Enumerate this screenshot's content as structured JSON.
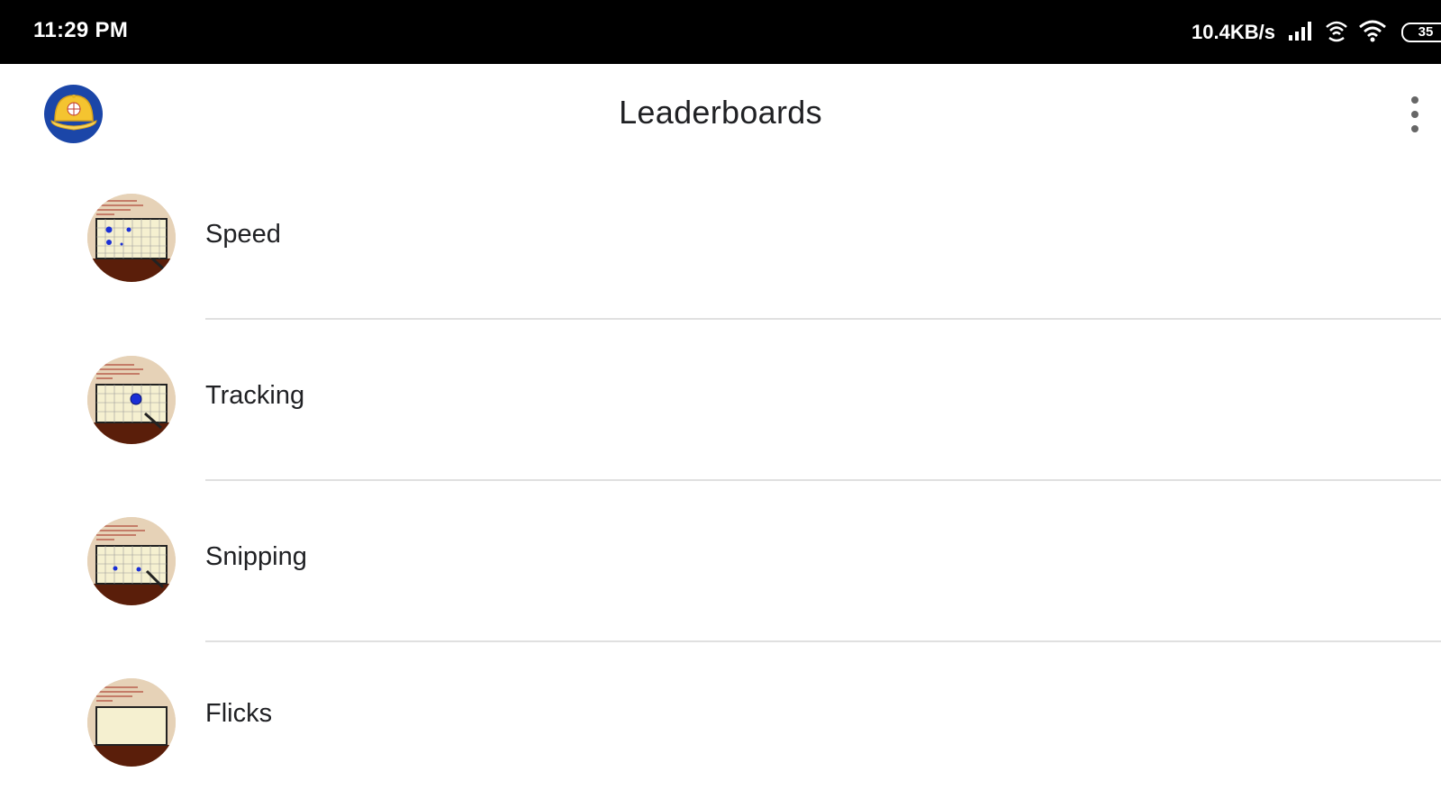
{
  "status_bar": {
    "time": "11:29 PM",
    "net_speed": "10.4KB/s",
    "battery": "35",
    "icons": [
      "signal-icon",
      "hotspot-icon",
      "wifi-icon",
      "battery-icon"
    ]
  },
  "app_bar": {
    "title": "Leaderboards",
    "logo_icon": "baseball-cap-logo",
    "menu_icon": "more-vert-icon"
  },
  "leaderboards": [
    {
      "label": "Speed",
      "icon": "speed-thumbnail"
    },
    {
      "label": "Tracking",
      "icon": "tracking-thumbnail"
    },
    {
      "label": "Snipping",
      "icon": "snipping-thumbnail"
    },
    {
      "label": "Flicks",
      "icon": "flicks-thumbnail"
    }
  ],
  "colors": {
    "status_bar": "#000000",
    "logo_bg": "#1b46a8",
    "cap": "#f4c430",
    "thumb_bg": "#e6d2b7",
    "thumb_floor": "#5a1e0a",
    "target": "#1a2fd6",
    "divider": "#e0e0e0"
  }
}
